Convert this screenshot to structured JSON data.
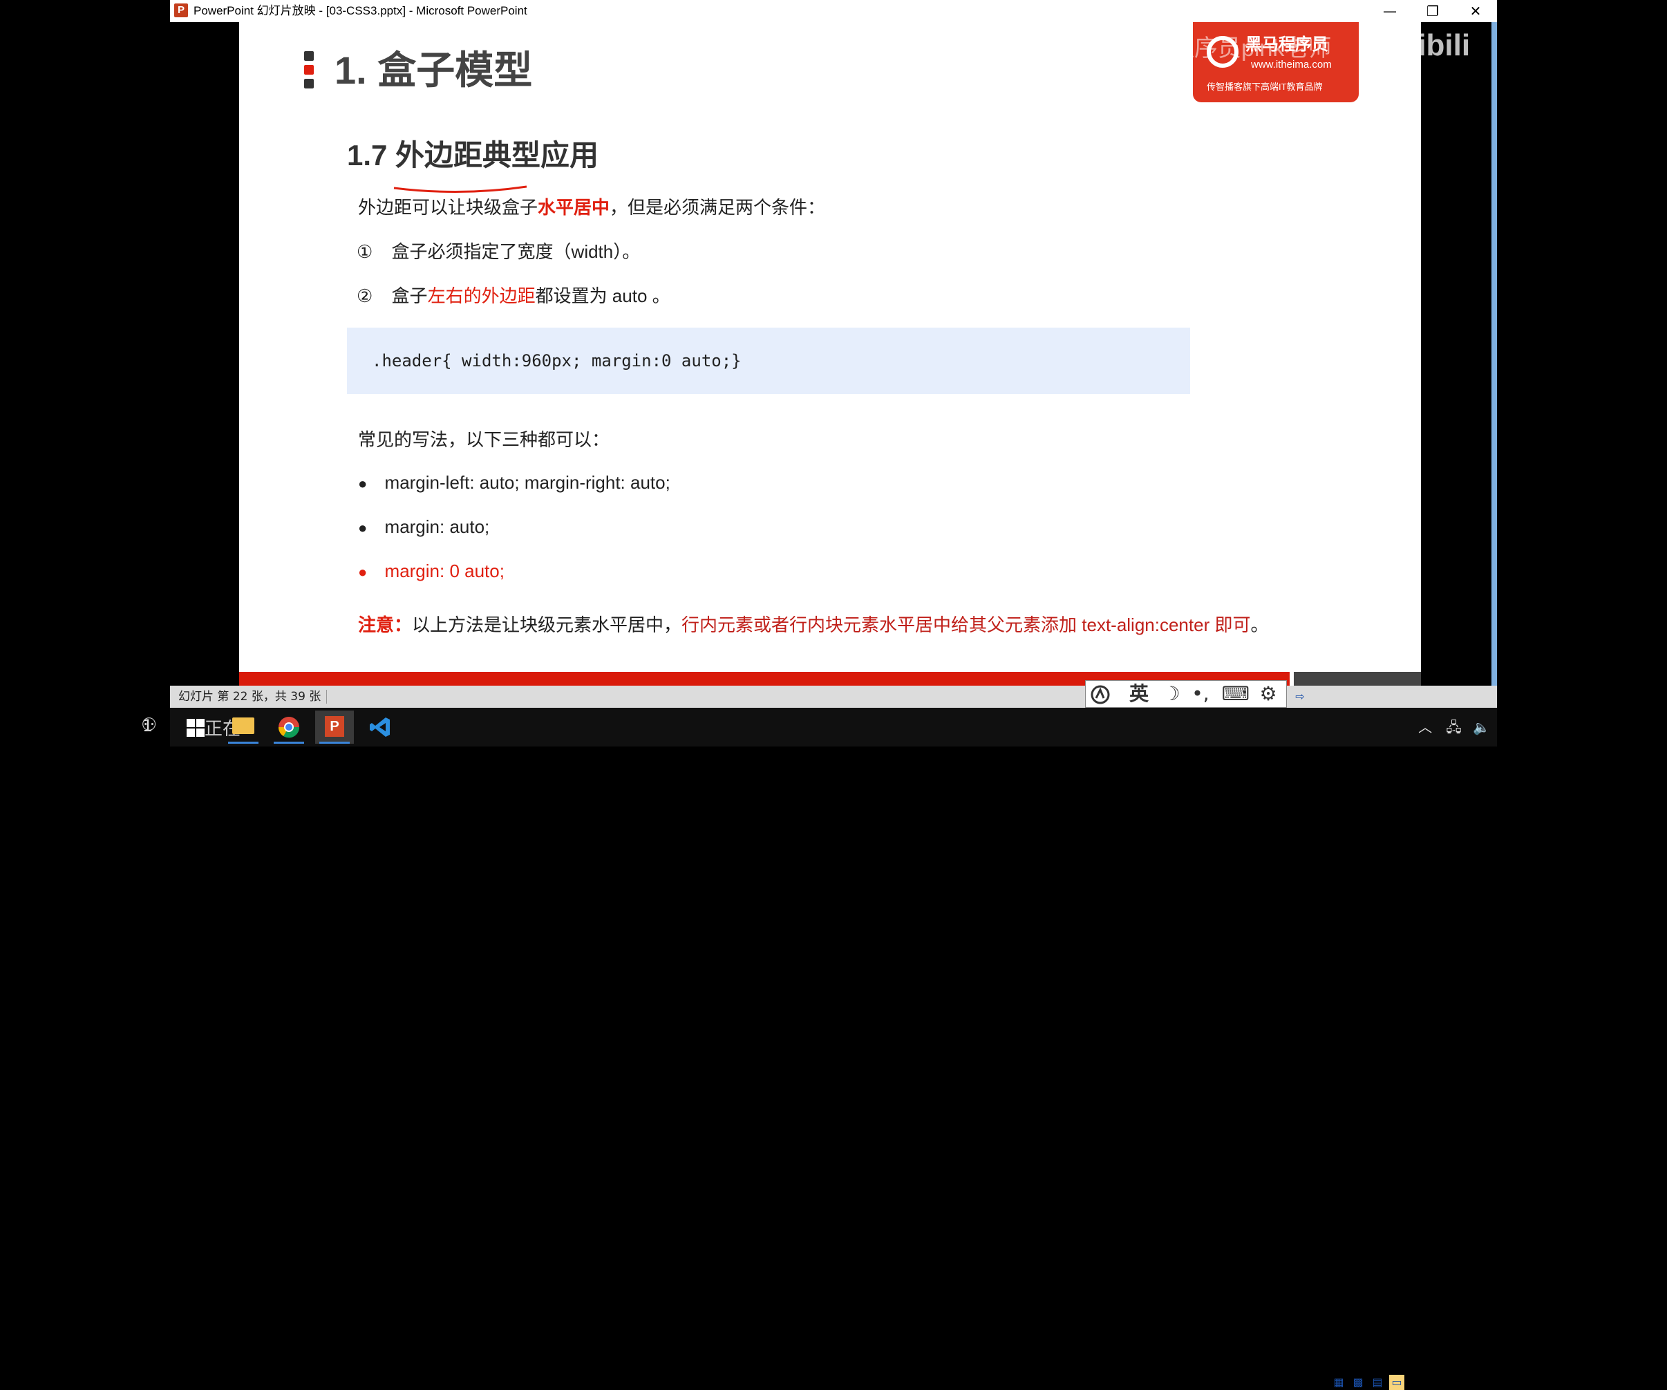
{
  "window": {
    "title": "PowerPoint 幻灯片放映 - [03-CSS3.pptx] - Microsoft PowerPoint",
    "app_icon": "P",
    "minimize": "—",
    "restore": "❐",
    "close": "✕"
  },
  "slide": {
    "heading": "1. 盒子模型",
    "subheading": "1.7 外边距典型应用",
    "intro": {
      "pre": "外边距可以让块级盒子",
      "highlight": "水平居中",
      "post": "，但是必须满足两个条件："
    },
    "conditions": [
      {
        "num": "①",
        "pre": "盒子必须指定了宽度（width）。",
        "highlight": "",
        "post": ""
      },
      {
        "num": "②",
        "pre": "盒子",
        "highlight": "左右的外边距",
        "post": "都设置为 auto 。"
      }
    ],
    "code": ".header{ width:960px; margin:0 auto;}",
    "common_label": "常见的写法，以下三种都可以：",
    "options": [
      {
        "marker": "●",
        "text": "margin-left: auto;   margin-right: auto;"
      },
      {
        "marker": "●",
        "text": "margin: auto;"
      },
      {
        "marker": "●",
        "text": "margin: 0 auto;"
      }
    ],
    "note": {
      "label": "注意：",
      "pre": "以上方法是让块级元素水平居中，",
      "highlight": "行内元素或者行内块元素水平居中给其父元素添加 text-align:center 即可",
      "post": "。"
    },
    "logo": {
      "name": "黑马程序员",
      "url": "www.itheima.com",
      "slogan": "传智播客旗下高端IT教育品牌"
    }
  },
  "statusbar": {
    "slide_counter": "幻灯片 第 22 张，共 39 张"
  },
  "ime": {
    "mode": "英",
    "moon": "☽",
    "punct": "•,",
    "keyboard": "⌨",
    "settings": "⚙"
  },
  "taskbar": {
    "search_text": "正在",
    "tray_time": "",
    "left_num": "1"
  },
  "watermark": {
    "text": "bilibili",
    "author": "星子程序员pink老师"
  },
  "colors": {
    "accent_red": "#e02010",
    "code_bg": "#e6eefc",
    "heading": "#444444"
  }
}
